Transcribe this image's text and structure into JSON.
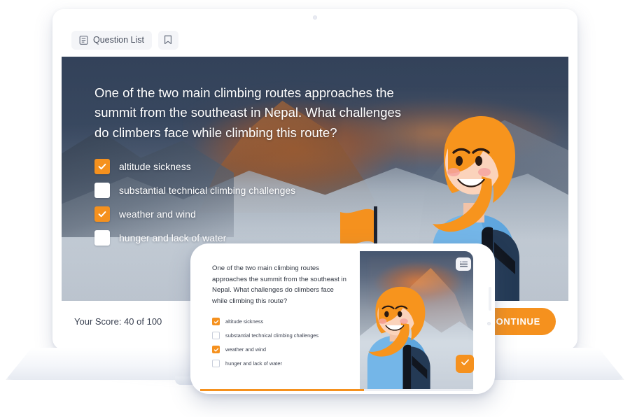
{
  "toolbar": {
    "question_list_label": "Question List",
    "question_list_icon": "list-document-icon",
    "bookmark_icon": "bookmark-icon"
  },
  "slide": {
    "question": "One of the two main climbing routes approaches the summit from the  southeast in Nepal. What challenges do climbers face while climbing this route?",
    "options": [
      {
        "label": "altitude sickness",
        "checked": true
      },
      {
        "label": "substantial technical climbing challenges",
        "checked": false
      },
      {
        "label": "weather and wind",
        "checked": true
      },
      {
        "label": "hunger and lack of water",
        "checked": false
      }
    ]
  },
  "footer": {
    "score_text": "Your Score: 40 of 100",
    "continue_label": "CONTINUE"
  },
  "phone": {
    "question": "One of the two main climbing routes approaches the summit from the southeast in Nepal. What challenges do climbers face while climbing this route?",
    "options": [
      {
        "label": "altitude sickness",
        "checked": true
      },
      {
        "label": "substantial technical climbing challenges",
        "checked": false
      },
      {
        "label": "weather and wind",
        "checked": true
      },
      {
        "label": "hunger and lack of water",
        "checked": false
      }
    ],
    "menu_icon": "list-menu-icon",
    "submit_icon": "check-icon",
    "progress_percent": 60
  },
  "colors": {
    "accent": "#f5911e",
    "text_dark": "#3b4252",
    "toolbar_bg": "#f4f5f8"
  }
}
